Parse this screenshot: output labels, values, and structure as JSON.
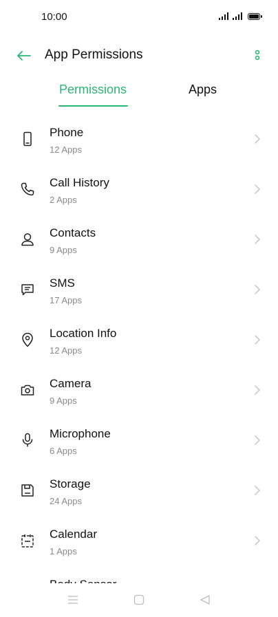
{
  "status_bar": {
    "time": "10:00"
  },
  "toolbar": {
    "title": "App Permissions"
  },
  "tabs": [
    {
      "label": "Permissions",
      "active": true
    },
    {
      "label": "Apps",
      "active": false
    }
  ],
  "accent_color": "#2bb673",
  "permissions": [
    {
      "label": "Phone",
      "count": "12 Apps",
      "icon": "phone-icon"
    },
    {
      "label": "Call History",
      "count": "2 Apps",
      "icon": "call-icon"
    },
    {
      "label": "Contacts",
      "count": "9 Apps",
      "icon": "person-icon"
    },
    {
      "label": "SMS",
      "count": "17 Apps",
      "icon": "message-icon"
    },
    {
      "label": "Location Info",
      "count": "12 Apps",
      "icon": "location-icon"
    },
    {
      "label": "Camera",
      "count": "9 Apps",
      "icon": "camera-icon"
    },
    {
      "label": "Microphone",
      "count": "6 Apps",
      "icon": "microphone-icon"
    },
    {
      "label": "Storage",
      "count": "24 Apps",
      "icon": "storage-icon"
    },
    {
      "label": "Calendar",
      "count": "1 Apps",
      "icon": "calendar-icon"
    },
    {
      "label": "Body Sensor",
      "count": "",
      "icon": "sensor-icon"
    }
  ]
}
